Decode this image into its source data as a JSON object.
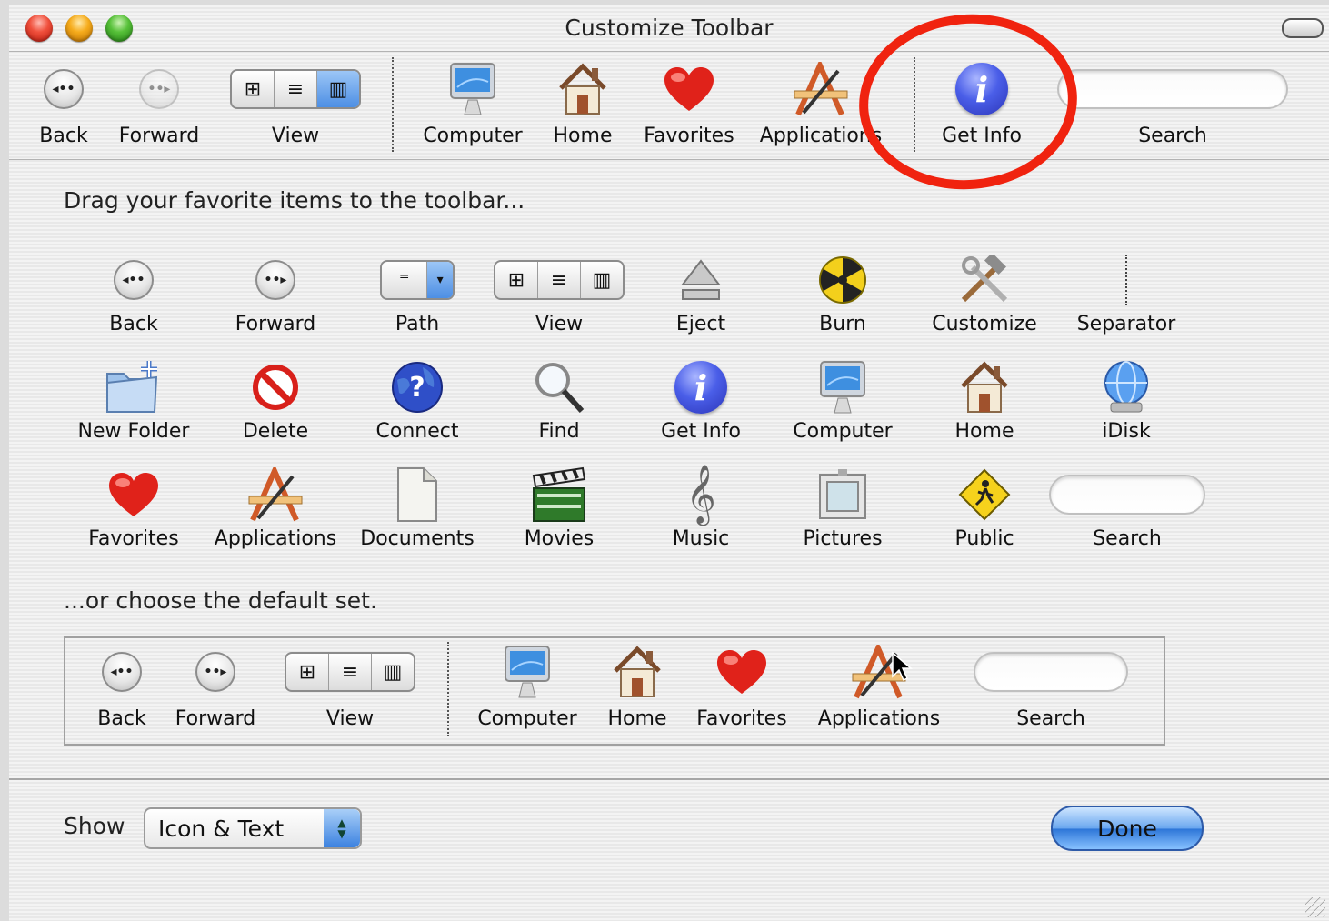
{
  "window": {
    "title": "Customize Toolbar"
  },
  "toolbar": {
    "back": "Back",
    "forward": "Forward",
    "view": "View",
    "computer": "Computer",
    "home": "Home",
    "favorites": "Favorites",
    "applications": "Applications",
    "get_info": "Get Info",
    "search": "Search"
  },
  "instructions": {
    "drag_text": "Drag your favorite items to the toolbar...",
    "default_text": "...or choose the default set."
  },
  "palette": {
    "row1": [
      "Back",
      "Forward",
      "Path",
      "View",
      "Eject",
      "Burn",
      "Customize",
      "Separator"
    ],
    "row2": [
      "New Folder",
      "Delete",
      "Connect",
      "Find",
      "Get Info",
      "Computer",
      "Home",
      "iDisk"
    ],
    "row3": [
      "Favorites",
      "Applications",
      "Documents",
      "Movies",
      "Music",
      "Pictures",
      "Public",
      "Search"
    ]
  },
  "default_set": {
    "back": "Back",
    "forward": "Forward",
    "view": "View",
    "computer": "Computer",
    "home": "Home",
    "favorites": "Favorites",
    "applications": "Applications",
    "search": "Search"
  },
  "footer": {
    "show_label": "Show",
    "show_value": "Icon & Text",
    "done_label": "Done"
  },
  "colors": {
    "annotation": "#f0230f",
    "accent_blue": "#3c82e0"
  }
}
